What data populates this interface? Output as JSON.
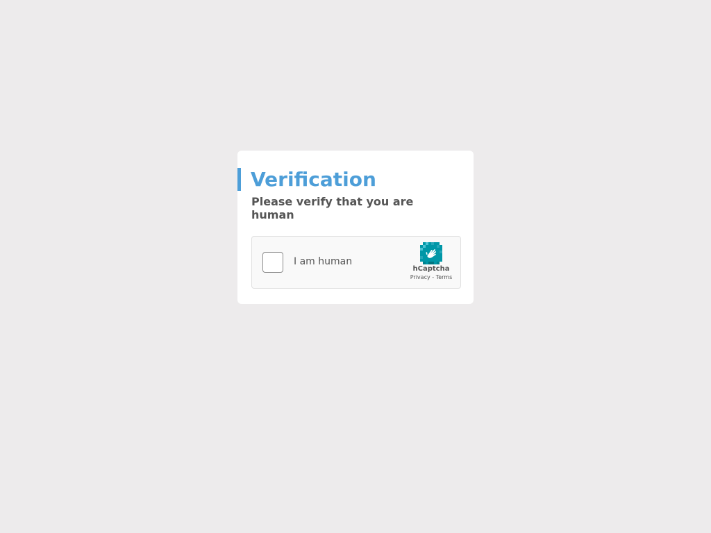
{
  "card": {
    "title": "Verification",
    "subtitle": "Please verify that you are human"
  },
  "captcha": {
    "checkbox_label": "I am human",
    "brand_name": "hCaptcha",
    "privacy_label": "Privacy",
    "separator": " - ",
    "terms_label": "Terms",
    "logo_icon": "hcaptcha-hand-icon",
    "checked": false
  },
  "colors": {
    "background": "#edebec",
    "accent": "#4d9ed8",
    "text": "#555555",
    "logo_teal": "#00838f",
    "logo_light": "#4dc2d4"
  }
}
